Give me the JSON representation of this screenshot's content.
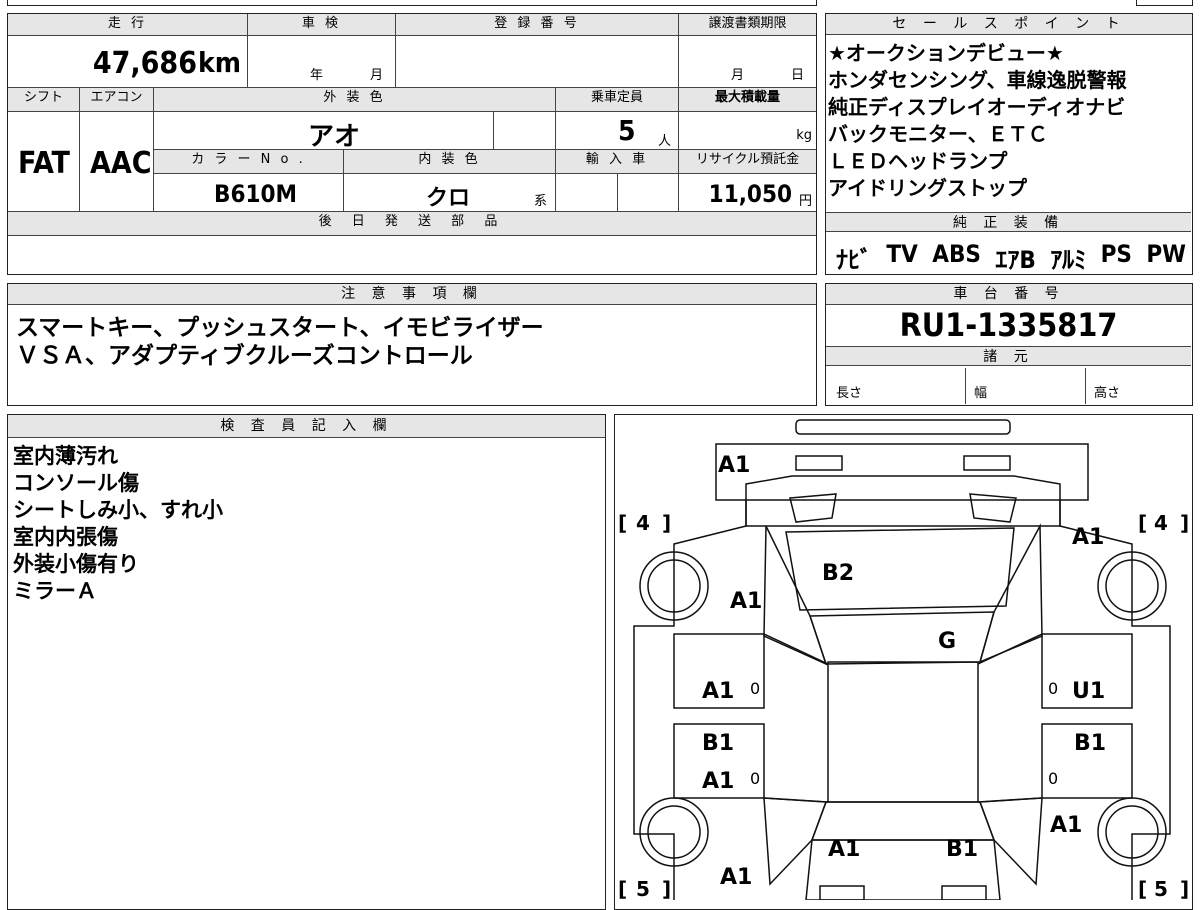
{
  "top_left": {
    "mileage_label": "走 行",
    "mileage_value": "47,686",
    "mileage_unit": "km",
    "inspection_label": "車 検",
    "inspection_year": "年",
    "inspection_month": "月",
    "reg_label": "登 録 番 号",
    "doc_label": "譲渡書類期限",
    "doc_month": "月",
    "doc_day": "日",
    "shift_label": "シフト",
    "shift_value": "FAT",
    "ac_label": "エアコン",
    "ac_value": "AAC",
    "ext_color_label": "外 装 色",
    "ext_color_value": "アオ",
    "capacity_label": "乗車定員",
    "capacity_value": "5",
    "capacity_unit": "人",
    "max_load_label": "最大積載量",
    "max_load_unit": "kg",
    "color_no_label": "カ ラ ー N o .",
    "color_no_value": "B610M",
    "int_color_label": "内 装 色",
    "int_color_value": "クロ",
    "int_color_suffix": "系",
    "import_label": "輸 入 車",
    "recycle_label": "リサイクル預託金",
    "recycle_value": "11,050",
    "recycle_unit": "円",
    "later_parts_label": "後 日 発 送 部 品"
  },
  "sales_points": {
    "label": "セ ー ル ス ポ イ ン ト",
    "lines": [
      "★オークションデビュー★",
      "ホンダセンシング、車線逸脱警報",
      "純正ディスプレイオーディオナビ",
      "バックモニター、ＥＴＣ",
      "ＬＥＤヘッドランプ",
      "アイドリングストップ"
    ]
  },
  "equipment": {
    "label": "純 正 装 備",
    "items": [
      "ﾅﾋﾞ",
      "TV",
      "ABS",
      "ｴｱB",
      "ｱﾙﾐ",
      "PS",
      "PW"
    ]
  },
  "notes": {
    "label": "注 意 事 項 欄",
    "lines": [
      "スマートキー、プッシュスタート、イモビライザー",
      "ＶＳＡ、アダプティブクルーズコントロール"
    ]
  },
  "chassis": {
    "label": "車 台 番 号",
    "value": "RU1-1335817",
    "spec_label": "諸 元",
    "length_label": "長さ",
    "width_label": "幅",
    "height_label": "高さ"
  },
  "inspector": {
    "label": "検 査 員 記 入 欄",
    "lines": [
      "室内薄汚れ",
      "コンソール傷",
      "シートしみ小、すれ小",
      "室内内張傷",
      "外装小傷有り",
      "ミラーＡ"
    ]
  },
  "diagram": {
    "marks": [
      {
        "id": "rear-bumper",
        "text": "A1"
      },
      {
        "id": "left-front-fender",
        "text": "A1"
      },
      {
        "id": "hood",
        "text": "B2"
      },
      {
        "id": "right-front-fender",
        "text": "A1"
      },
      {
        "id": "windshield",
        "text": "G"
      },
      {
        "id": "left-front-door",
        "text": "A1"
      },
      {
        "id": "right-front-door",
        "text": "U1"
      },
      {
        "id": "left-step",
        "text": "B1"
      },
      {
        "id": "right-step",
        "text": "B1"
      },
      {
        "id": "left-rear-door",
        "text": "A1"
      },
      {
        "id": "right-rear-quarter",
        "text": "A1"
      },
      {
        "id": "rear-left",
        "text": "A1"
      },
      {
        "id": "rear-right",
        "text": "B1"
      },
      {
        "id": "left-rear-quarter",
        "text": "A1"
      }
    ],
    "tire_front_left": "4",
    "tire_front_right": "4",
    "tire_rear_left": "5",
    "tire_rear_right": "5",
    "zero_marks": [
      "0",
      "0",
      "0",
      "0"
    ]
  }
}
